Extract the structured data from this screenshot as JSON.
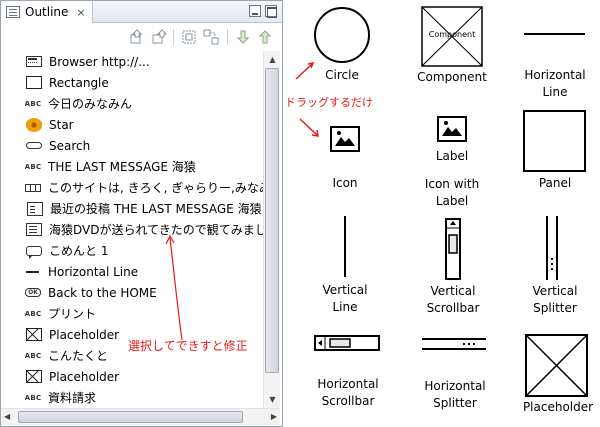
{
  "outline": {
    "tab_label": "Outline",
    "close_glyph": "×",
    "items": [
      {
        "icon": "browser-icon",
        "label": "Browser http://..."
      },
      {
        "icon": "rectangle-icon",
        "label": "Rectangle"
      },
      {
        "icon": "text-abc-icon",
        "label": "今日のみなみん",
        "abc": "ABC"
      },
      {
        "icon": "star-icon",
        "label": "Star"
      },
      {
        "icon": "search-icon",
        "label": "Search"
      },
      {
        "icon": "text-abc-icon",
        "label": "THE LAST MESSAGE 海猿",
        "abc": "ABC"
      },
      {
        "icon": "iframe-icon",
        "label": "このサイトは, きろく, ぎゃらりー,みなみ"
      },
      {
        "icon": "document-icon",
        "label": "最近の投稿 THE LAST MESSAGE 海猿"
      },
      {
        "icon": "text-block-icon",
        "label": "海猿DVDが送られてきたので観てみまし"
      },
      {
        "icon": "comment-icon",
        "label": "こめんと 1"
      },
      {
        "icon": "horizontal-line-icon",
        "label": "Horizontal Line"
      },
      {
        "icon": "ok-button-icon",
        "label": "Back to the HOME",
        "ok": "OK"
      },
      {
        "icon": "text-abc-icon",
        "label": "プリント",
        "abc": "ABC"
      },
      {
        "icon": "placeholder-icon",
        "label": "Placeholder"
      },
      {
        "icon": "text-abc-icon",
        "label": "こんたくと",
        "abc": "ABC"
      },
      {
        "icon": "placeholder-icon",
        "label": "Placeholder"
      },
      {
        "icon": "text-abc-icon",
        "label": "資料請求",
        "abc": "ABC"
      }
    ]
  },
  "palette": {
    "circle": "Circle",
    "component": "Component",
    "component_inner": "Component",
    "horizontal_line": "Horizontal\nLine",
    "icon": "Icon",
    "label": "Label",
    "icon_with_label": "Icon with\nLabel",
    "panel": "Panel",
    "vertical_line": "Vertical\nLine",
    "vertical_scrollbar": "Vertical\nScrollbar",
    "vertical_splitter": "Vertical\nSplitter",
    "horizontal_scrollbar": "Horizontal\nScrollbar",
    "horizontal_splitter": "Horizontal\nSplitter",
    "placeholder": "Placeholder"
  },
  "annotations": {
    "drag": "ドラッグするだけ",
    "select_edit": "選択してできすと修正"
  },
  "colors": {
    "annotation_red": "#e81a1a",
    "star_orange": "#f0a000"
  }
}
